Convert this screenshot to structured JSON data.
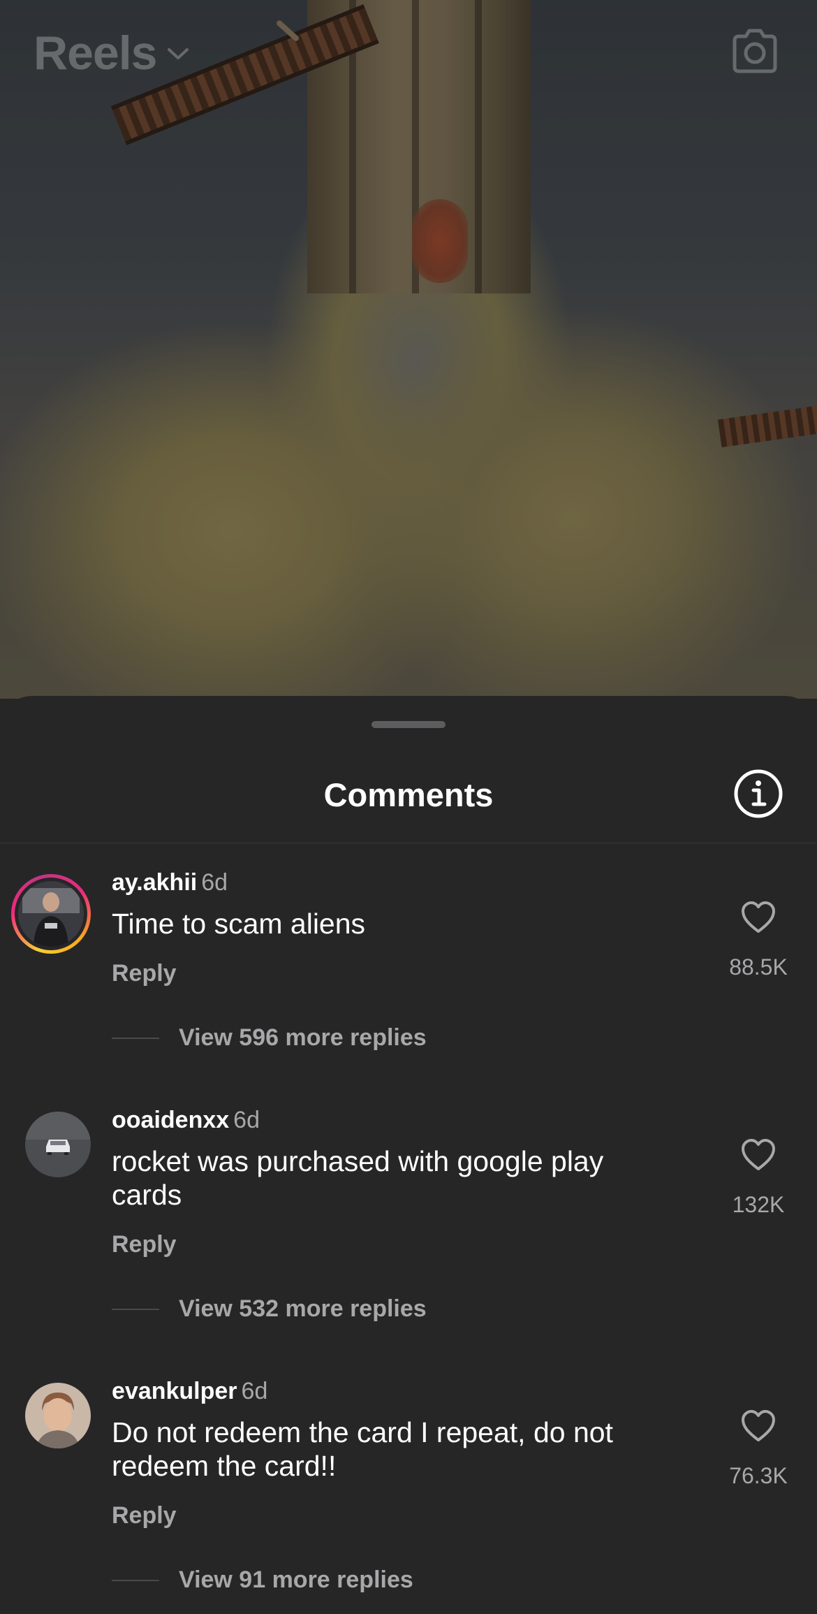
{
  "header": {
    "title": "Reels",
    "title_icon": "chevron-down-icon",
    "camera_icon": "camera-icon"
  },
  "sheet": {
    "title": "Comments",
    "info_icon": "info-icon"
  },
  "comments": [
    {
      "username": "ay.akhii",
      "time": "6d",
      "text": "Time to scam aliens",
      "reply_label": "Reply",
      "likes": "88.5K",
      "view_replies": "View 596 more replies",
      "has_story_ring": true
    },
    {
      "username": "ooaidenxx",
      "time": "6d",
      "text": "rocket was purchased with google play cards",
      "reply_label": "Reply",
      "likes": "132K",
      "view_replies": "View 532 more replies",
      "has_story_ring": false
    },
    {
      "username": "evankulper",
      "time": "6d",
      "text": "Do not redeem the card I repeat, do not redeem the card!!",
      "reply_label": "Reply",
      "likes": "76.3K",
      "view_replies": "View 91 more replies",
      "has_story_ring": false
    }
  ],
  "colors": {
    "sheet_bg": "#262627",
    "secondary_text": "#a8a8aa",
    "primary_text": "#ffffff"
  }
}
